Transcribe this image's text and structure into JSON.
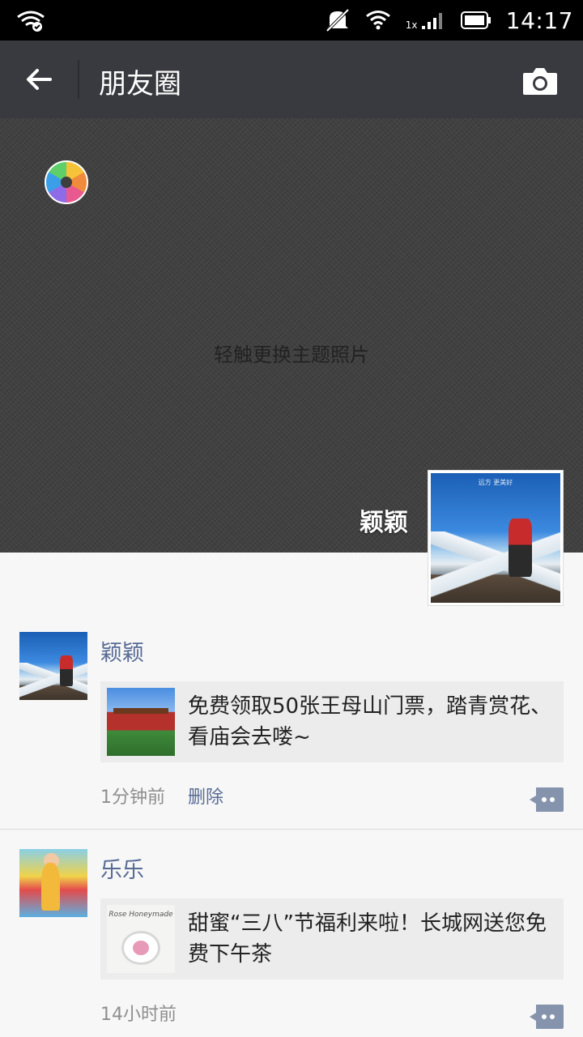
{
  "status_bar": {
    "time": "14:17",
    "network_label": "1x"
  },
  "header": {
    "title": "朋友圈"
  },
  "cover": {
    "hint": "轻触更换主题照片",
    "user_name": "颖颖",
    "avatar_caption": "远方  更美好"
  },
  "posts": [
    {
      "author": "颖颖",
      "link_text": "免费领取50张王母山门票，踏青赏花、看庙会去喽~",
      "time": "1分钟前",
      "delete_label": "删除"
    },
    {
      "author": "乐乐",
      "link_text": "甜蜜“三八”节福利来啦！长城网送您免费下午茶",
      "time": "14小时前",
      "thumb_caption": "Rose Honeymade"
    }
  ],
  "colors": {
    "title_bar": "#393a3f",
    "name_link": "#576b95",
    "cover": "#3e3e3e"
  }
}
